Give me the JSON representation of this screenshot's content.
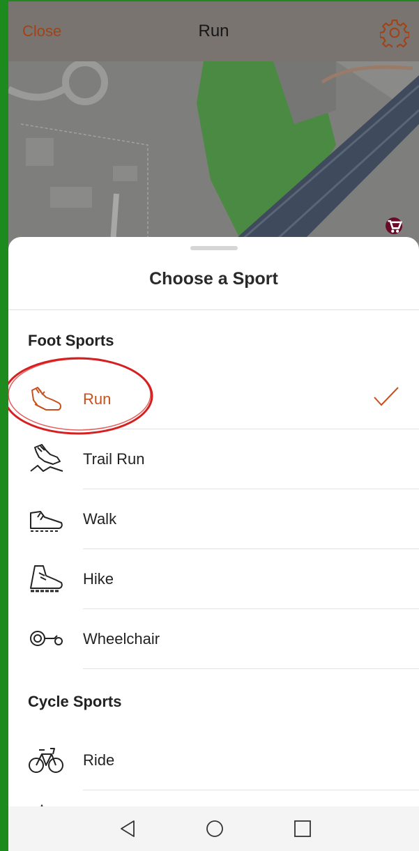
{
  "topbar": {
    "close_label": "Close",
    "title": "Run",
    "settings_icon": "gear-icon"
  },
  "sheet": {
    "title": "Choose a Sport",
    "sections": [
      {
        "label": "Foot Sports",
        "items": [
          {
            "label": "Run",
            "icon": "running-shoe-icon",
            "selected": true
          },
          {
            "label": "Trail Run",
            "icon": "trail-run-icon",
            "selected": false
          },
          {
            "label": "Walk",
            "icon": "walking-shoe-icon",
            "selected": false
          },
          {
            "label": "Hike",
            "icon": "hiking-boot-icon",
            "selected": false
          },
          {
            "label": "Wheelchair",
            "icon": "wheelchair-icon",
            "selected": false
          }
        ]
      },
      {
        "label": "Cycle Sports",
        "items": [
          {
            "label": "Ride",
            "icon": "bicycle-icon",
            "selected": false
          }
        ]
      }
    ]
  },
  "colors": {
    "accent": "#c8501c",
    "frame": "#1c8a1c",
    "annotation": "#d62020"
  },
  "navbar": {
    "icons": [
      "back-triangle-icon",
      "home-circle-icon",
      "recents-square-icon"
    ]
  }
}
